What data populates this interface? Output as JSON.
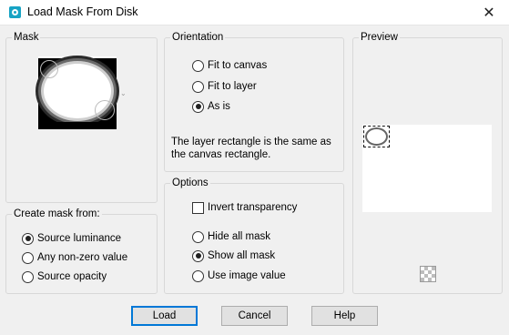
{
  "window": {
    "title": "Load Mask From Disk",
    "close_glyph": "✕",
    "app_icon": "psp-mask-icon"
  },
  "mask": {
    "legend": "Mask",
    "thumbnail": "mask-thumbnail",
    "dropdown_glyph": "⌄"
  },
  "create_mask": {
    "legend": "Create mask from:",
    "options": [
      {
        "label": "Source luminance",
        "checked": true
      },
      {
        "label": "Any non-zero value",
        "checked": false
      },
      {
        "label": "Source opacity",
        "checked": false
      }
    ]
  },
  "orientation": {
    "legend": "Orientation",
    "options": [
      {
        "label": "Fit to canvas",
        "checked": false
      },
      {
        "label": "Fit to layer",
        "checked": false
      },
      {
        "label": "As is",
        "checked": true
      }
    ],
    "description": "The layer rectangle is the same as the canvas rectangle."
  },
  "options": {
    "legend": "Options",
    "invert_label": "Invert transparency",
    "invert_checked": false,
    "radios": [
      {
        "label": "Hide all mask",
        "checked": false
      },
      {
        "label": "Show all mask",
        "checked": true
      },
      {
        "label": "Use image value",
        "checked": false
      }
    ]
  },
  "preview": {
    "legend": "Preview",
    "transparency_icon": "checkerboard-icon"
  },
  "buttons": {
    "load": "Load",
    "cancel": "Cancel",
    "help": "Help"
  }
}
